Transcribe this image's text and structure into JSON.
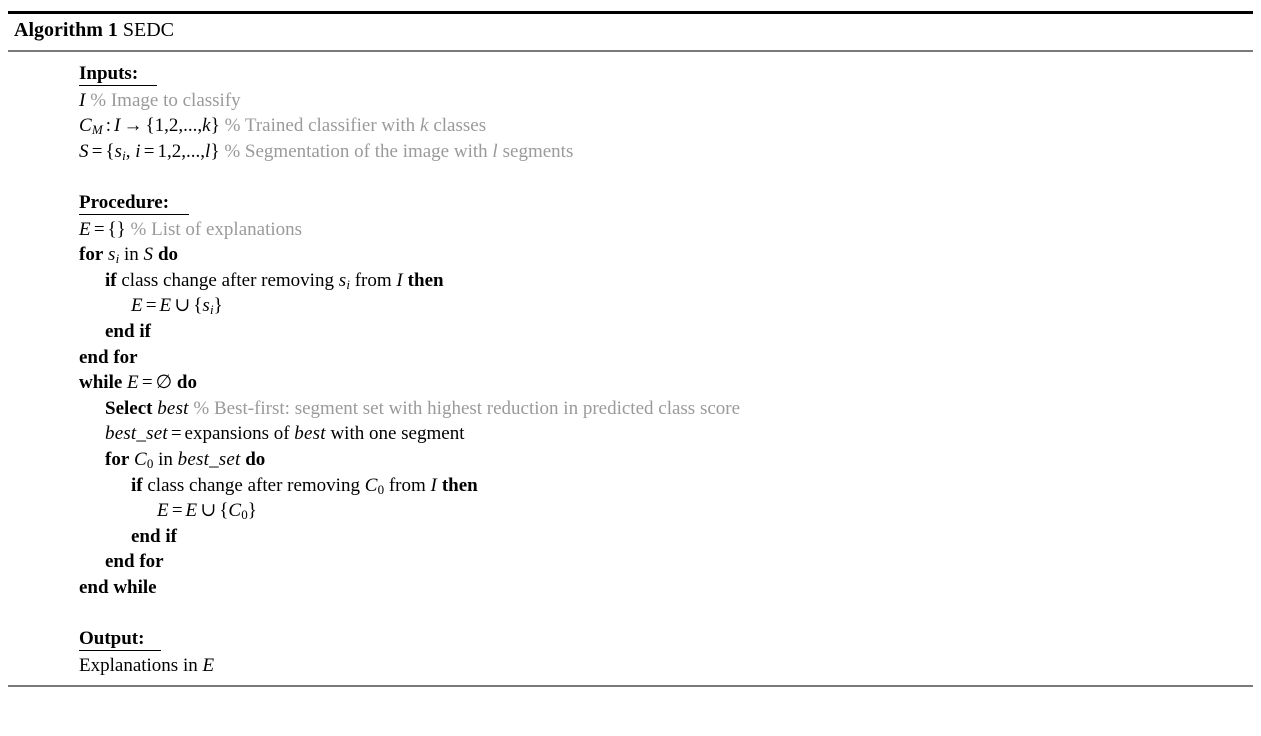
{
  "header": {
    "label": "Algorithm 1",
    "name": "SEDC"
  },
  "sections": {
    "inputs_heading": "Inputs:",
    "procedure_heading": "Procedure:",
    "output_heading": "Output:"
  },
  "inputs": {
    "line1": {
      "var": "I",
      "comment": "% Image to classify"
    },
    "line2": {
      "var": "C",
      "sub": "M",
      "colon": ":",
      "arg": "I",
      "arrow": "→",
      "set": "{1,2,...,",
      "setvar": "k",
      "setclose": "}",
      "comment_pre": "% Trained classifier with ",
      "comment_var": "k",
      "comment_post": " classes"
    },
    "line3": {
      "var": "S",
      "eq": "=",
      "open": "{",
      "s": "s",
      "ssub": "i",
      "comma": ", ",
      "i": "i",
      "eq2": "=",
      "range": "1,2,...,",
      "l": "l",
      "close": "}",
      "comment_pre": "% Segmentation of the image with ",
      "comment_var": "l",
      "comment_post": " segments"
    }
  },
  "procedure": {
    "l1": {
      "var": "E",
      "eq": "=",
      "empty": "{}",
      "comment": "% List of explanations"
    },
    "l2": {
      "kw_for": "for",
      "var": "s",
      "sub": "i",
      "in": "in",
      "set": "S",
      "kw_do": "do"
    },
    "l3": {
      "kw_if": "if",
      "text1": "class change after removing",
      "var": "s",
      "sub": "i",
      "text2": "from",
      "img": "I",
      "kw_then": "then"
    },
    "l4": {
      "lhs": "E",
      "eq": "=",
      "rhs": "E",
      "union": "∪",
      "open": "{",
      "s": "s",
      "sub": "i",
      "close": "}"
    },
    "l5": {
      "text": "end if"
    },
    "l6": {
      "text": "end for"
    },
    "l7": {
      "kw_while": "while",
      "var": "E",
      "eq": "=",
      "emptyset": "∅",
      "kw_do": "do"
    },
    "l8": {
      "kw_select": "Select",
      "var": "best",
      "comment": "% Best-first: segment set with highest reduction in predicted class score"
    },
    "l9": {
      "lhs": "best_set",
      "eq": "=",
      "text1": "expansions of",
      "var": "best",
      "text2": "with one segment"
    },
    "l10": {
      "kw_for": "for",
      "var": "C",
      "sub": "0",
      "in": "in",
      "set": "best_set",
      "kw_do": "do"
    },
    "l11": {
      "kw_if": "if",
      "text1": "class change after removing",
      "var": "C",
      "sub": "0",
      "text2": "from",
      "img": "I",
      "kw_then": "then"
    },
    "l12": {
      "lhs": "E",
      "eq": "=",
      "rhs": "E",
      "union": "∪",
      "open": "{",
      "c": "C",
      "sub": "0",
      "close": "}"
    },
    "l13": {
      "text": "end if"
    },
    "l14": {
      "text": "end for"
    },
    "l15": {
      "text": "end while"
    }
  },
  "output": {
    "text_pre": "Explanations in ",
    "var": "E"
  },
  "colors": {
    "comment": "#9a9a9a",
    "rule_dark": "#000000",
    "rule_light": "#7a7a7a",
    "text": "#000000"
  }
}
